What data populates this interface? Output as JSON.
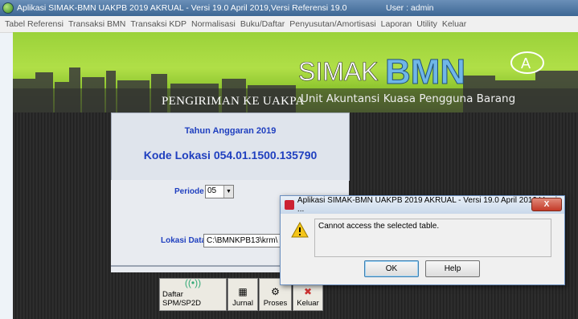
{
  "window": {
    "title": "Aplikasi SIMAK-BMN UAKPB 2019 AKRUAL - Versi 19.0 April 2019,Versi Referensi 19.0",
    "user": "User : admin"
  },
  "menu": [
    "Tabel Referensi",
    "Transaksi BMN",
    "Transaksi KDP",
    "Normalisasi",
    "Buku/Daftar",
    "Penyusutan/Amortisasi",
    "Laporan",
    "Utility",
    "Keluar"
  ],
  "banner": {
    "title": "PENGIRIMAN KE UAKPA",
    "subtitle": "Unit Akuntansi Kuasa Pengguna Barang",
    "logo_simak": "SIMAK",
    "logo_bmn": "BMN",
    "logo_a": "A"
  },
  "info": {
    "tahun": "Tahun Anggaran 2019",
    "kode": "Kode Lokasi  054.01.1500.135790"
  },
  "form": {
    "periode_label": "Periode",
    "periode_value": "05",
    "lokasi_label": "Lokasi Data",
    "lokasi_value": "C:\\BMNKPB13\\krm\\"
  },
  "toolbar": {
    "daftar": "Daftar SPM/SP2D",
    "jurnal": "Jurnal",
    "proses": "Proses",
    "keluar": "Keluar"
  },
  "dialog": {
    "title": "Aplikasi SIMAK-BMN UAKPB 2019 AKRUAL - Versi 19.0 April 2019,Versi ...",
    "message": "Cannot access the selected table.",
    "ok": "OK",
    "help": "Help",
    "close": "X"
  },
  "colors": {
    "label_blue": "#1f3fbf",
    "banner_green": "#9bd23a",
    "titlebar": "#3d6794"
  }
}
